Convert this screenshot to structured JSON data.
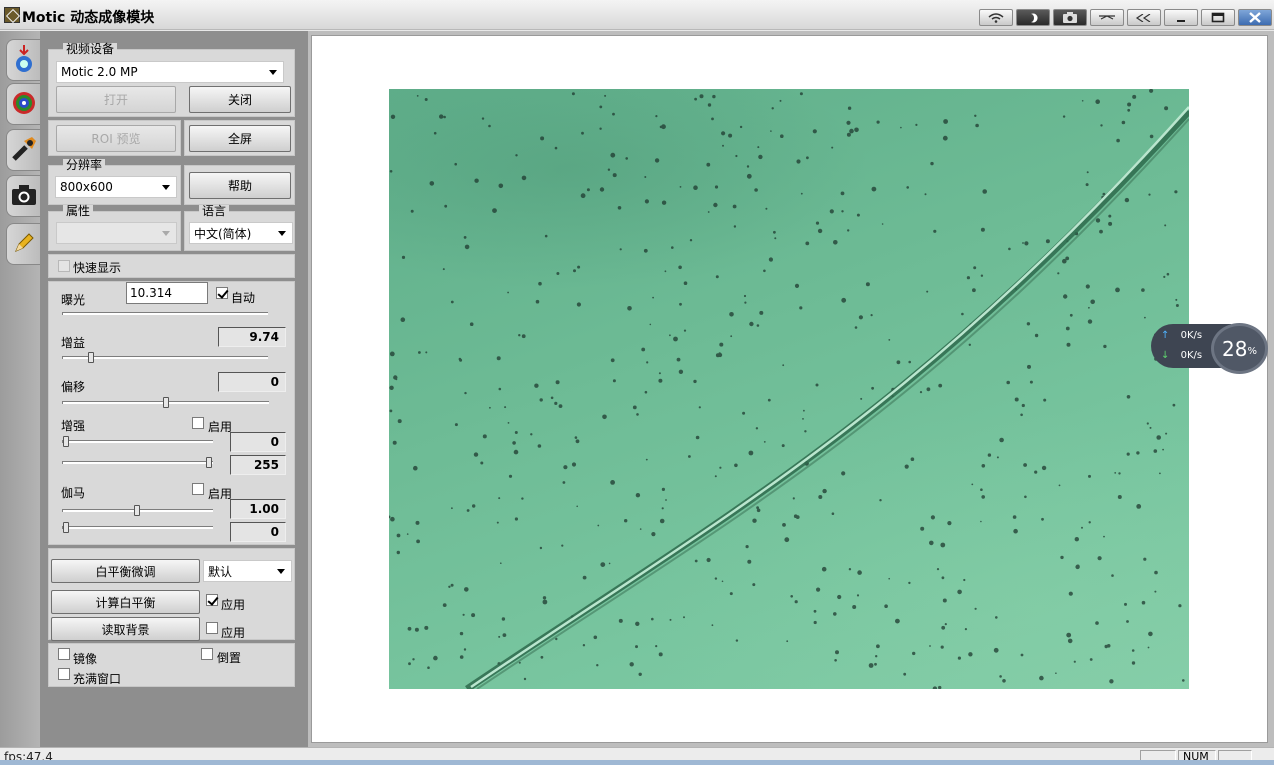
{
  "window": {
    "title": "Motic 动态成像模块"
  },
  "title_buttons": {
    "minimize": "minimize-button",
    "maximize": "maximize-button",
    "close": "close-button"
  },
  "side_tabs": [
    "capture-tab-icon",
    "color-tab-icon",
    "tools-tab-icon",
    "camera-tab-icon",
    "pencil-tab-icon"
  ],
  "panel": {
    "video_device": {
      "legend": "视频设备",
      "device": "Motic 2.0 MP",
      "open_label": "打开",
      "close_label": "关闭"
    },
    "roi_label": "ROI 预览",
    "fullscreen_label": "全屏",
    "resolution": {
      "legend": "分辨率",
      "value": "800x600"
    },
    "help_label": "帮助",
    "properties": {
      "legend": "属性",
      "value": ""
    },
    "language": {
      "legend": "语言",
      "value": "中文(简体)"
    },
    "fast_display": {
      "label": "快速显示",
      "checked": false
    },
    "exposure": {
      "label": "曝光",
      "value": "10.314",
      "auto_label": "自动",
      "auto_checked": true
    },
    "gain": {
      "label": "增益",
      "value": "9.74"
    },
    "offset": {
      "label": "偏移",
      "value": "0"
    },
    "enhance": {
      "label": "增强",
      "enable_label": "启用",
      "min": "0",
      "max": "255"
    },
    "gamma": {
      "label": "伽马",
      "enable_label": "启用",
      "value": "1.00",
      "offset": "0"
    },
    "white_balance": {
      "fine_tune_label": "白平衡微调",
      "mode": "默认",
      "calc_label": "计算白平衡",
      "calc_apply_label": "应用",
      "calc_apply_checked": true,
      "read_bg_label": "读取背景",
      "read_bg_apply_label": "应用",
      "read_bg_apply_checked": false
    },
    "mirror_label": "镜像",
    "flip_label": "倒置",
    "fill_window_label": "充满窗口"
  },
  "network_widget": {
    "upload": "0K/s",
    "download": "0K/s",
    "percent": "28",
    "percent_unit": "%"
  },
  "status": {
    "fps": "fps:47.4",
    "num": "NUM"
  },
  "colors": {
    "panel_bg": "#8e8e8e",
    "group_bg": "#d9d9d9",
    "specimen_green": "#6dbb95"
  }
}
